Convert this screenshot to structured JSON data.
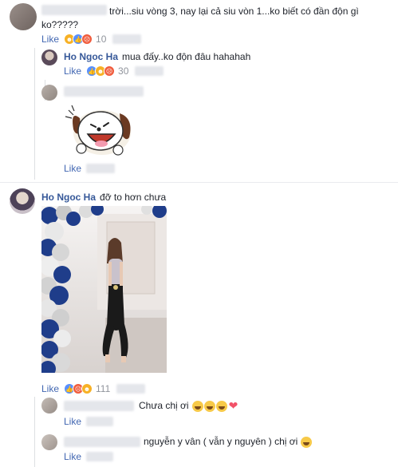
{
  "comments": [
    {
      "text": "trời...siu vòng 3, nay lại cả siu vòn 1...ko biết có đần độn gì",
      "text_line2": "ko?????",
      "like_label": "Like",
      "reaction_count": "10"
    },
    {
      "author": "Ho Ngoc Ha",
      "text": "mua đấy..ko độn đâu hahahah",
      "like_label": "Like",
      "reaction_count": "30"
    },
    {
      "like_label": "Like"
    },
    {
      "author": "Ho Ngoc Ha",
      "text": "đỡ to hơn chưa",
      "like_label": "Like",
      "reaction_count": "111"
    },
    {
      "text": "Chưa chị ơi",
      "like_label": "Like"
    },
    {
      "text": "nguyễn y vân ( vẫn y nguyên ) chị ơi",
      "like_label": "Like"
    }
  ],
  "icons": {
    "reactions": [
      "like-icon",
      "haha-icon",
      "angry-icon",
      "wow-icon"
    ],
    "sticker": "laughing-dog-sticker",
    "emoji": "laughing-tears-emoji",
    "heart": "heart-emoji"
  },
  "colors": {
    "author": "#365899",
    "like_link": "#4267b2",
    "muted": "#90949c",
    "heart": "#f25268"
  }
}
